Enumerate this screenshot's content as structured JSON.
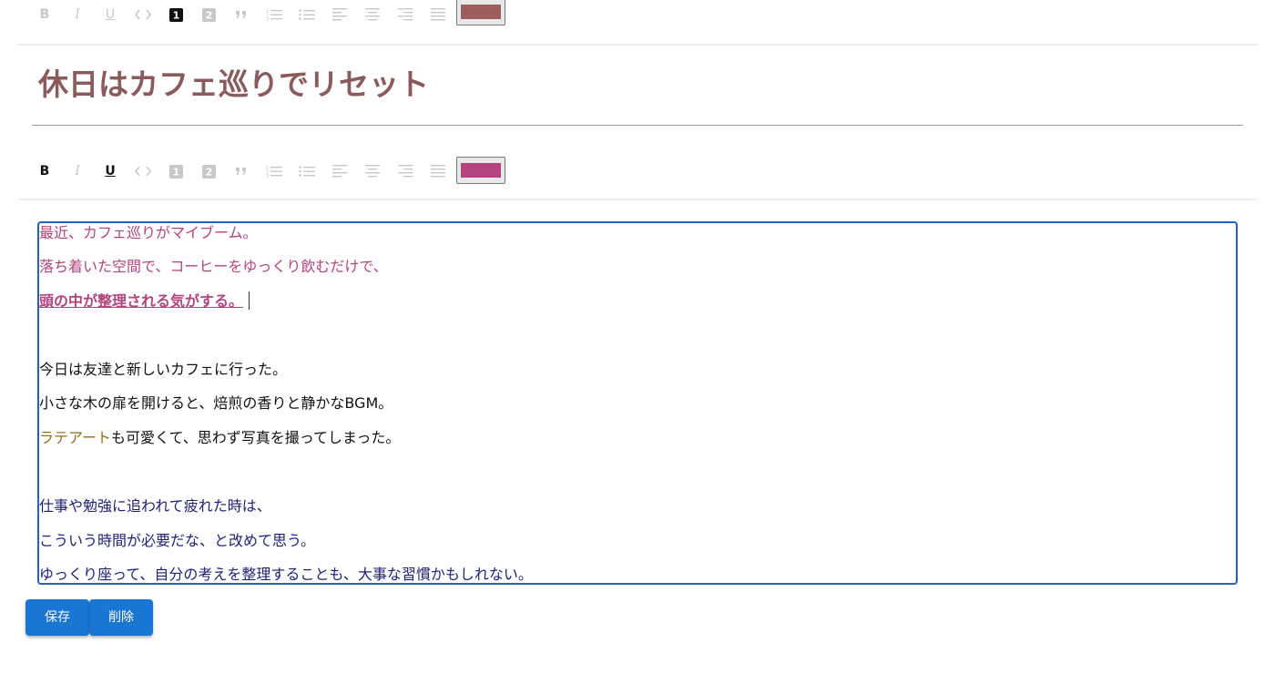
{
  "title_toolbar": {
    "active_buttons": [
      "h1"
    ],
    "color": "#9b5d5d"
  },
  "title": {
    "text": "休日はカフェ巡りでリセット",
    "color": "#8b5a5a"
  },
  "body_toolbar": {
    "active_buttons": [
      "bold",
      "underline"
    ],
    "color": "#b4437e"
  },
  "editor": {
    "lines": [
      {
        "text": "最近、カフェ巡りがマイブーム。",
        "color": "#b4437e"
      },
      {
        "text": "落ち着いた空間で、コーヒーをゆっくり飲むだけで、",
        "color": "#b4437e"
      },
      {
        "text": "頭の中が整理される気がする。",
        "color": "#b4437e",
        "style": "bold-underline"
      },
      {
        "text": "今日は友達と新しいカフェに行った。",
        "color": "#111111"
      },
      {
        "text": "小さな木の扉を開けると、焙煎の香りと静かなBGM。",
        "color": "#111111"
      },
      {
        "segments": [
          {
            "text": "ラテアート",
            "color": "#8a6d1a"
          },
          {
            "text": "も可愛くて、思わず写真を撮ってしまった。",
            "color": "#111111"
          }
        ]
      },
      {
        "text": "仕事や勉強に追われて疲れた時は、",
        "color": "#1f1f7a"
      },
      {
        "text": "こういう時間が必要だな、と改めて思う。",
        "color": "#1f1f7a"
      },
      {
        "text": "ゆっくり座って、自分の考えを整理することも、大事な習慣かもしれない。",
        "color": "#1f1f7a"
      }
    ]
  },
  "actions": {
    "save_label": "保存",
    "delete_label": "削除"
  }
}
